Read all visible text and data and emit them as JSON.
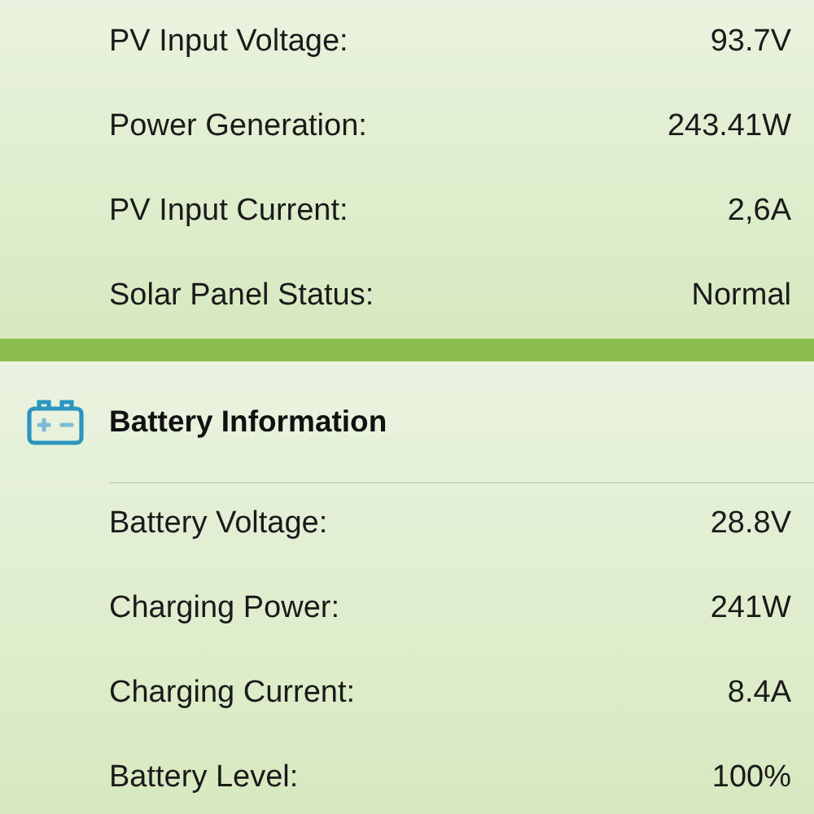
{
  "solar_panel": {
    "rows": [
      {
        "label": "PV Input Voltage:",
        "value": "93.7V"
      },
      {
        "label": "Power Generation:",
        "value": "243.41W"
      },
      {
        "label": "PV Input Current:",
        "value": "2,6A"
      },
      {
        "label": "Solar Panel Status:",
        "value": "Normal"
      }
    ]
  },
  "battery": {
    "title": "Battery Information",
    "rows": [
      {
        "label": "Battery Voltage:",
        "value": "28.8V"
      },
      {
        "label": "Charging Power:",
        "value": "241W"
      },
      {
        "label": "Charging Current:",
        "value": "8.4A"
      },
      {
        "label": "Battery Level:",
        "value": "100%"
      }
    ]
  }
}
